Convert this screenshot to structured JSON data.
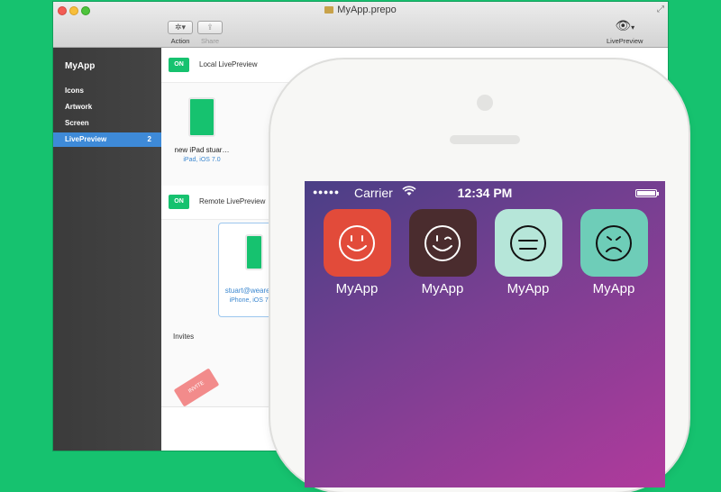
{
  "window": {
    "title": "MyApp.prepo",
    "toolbar": {
      "action_label": "Action",
      "share_label": "Share",
      "live_preview_label": "LivePreview"
    }
  },
  "sidebar": {
    "title": "MyApp",
    "items": [
      {
        "label": "Icons"
      },
      {
        "label": "Artwork"
      },
      {
        "label": "Screen"
      },
      {
        "label": "LivePreview",
        "badge": "2",
        "active": true
      }
    ]
  },
  "main": {
    "local": {
      "toggle": "ON",
      "label": "Local LivePreview",
      "device": {
        "name": "new iPad stuar…",
        "sub": "iPad, iOS 7.0"
      }
    },
    "remote": {
      "toggle": "ON",
      "label": "Remote LivePreview",
      "device": {
        "name": "stuart@wearem…",
        "sub": "iPhone, iOS 7.0.3"
      }
    },
    "invites_label": "Invites",
    "ticket_text": "INVITE"
  },
  "phone": {
    "status": {
      "signal": "●●●●●",
      "carrier": "Carrier",
      "time": "12:34 PM"
    },
    "apps": [
      {
        "label": "MyApp",
        "color": "#e24b3a",
        "icon": "smile-face-icon"
      },
      {
        "label": "MyApp",
        "color": "#4a2c2e",
        "icon": "wink-face-icon"
      },
      {
        "label": "MyApp",
        "color": "#b6e6d9",
        "icon": "neutral-face-icon"
      },
      {
        "label": "MyApp",
        "color": "#6ecdb8",
        "icon": "sad-face-icon"
      }
    ]
  },
  "colors": {
    "background": "#16c26f",
    "accent_green": "#16c26f",
    "selection_blue": "#3e8ad8"
  }
}
